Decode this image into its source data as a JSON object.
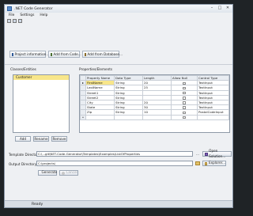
{
  "window": {
    "title": ".NET Code Generator"
  },
  "menu": [
    "File",
    "Settings",
    "Help"
  ],
  "toolbar": {
    "project_info": "Project information...",
    "add_from_code": "Add from Code...",
    "add_from_db": "Add from Database..."
  },
  "classes": {
    "label": "Classes/Entities",
    "items": [
      "Customer"
    ],
    "add": "Add",
    "rename": "Rename",
    "remove": "Remove"
  },
  "properties": {
    "label": "Properties/Elements",
    "columns": [
      "Property Name",
      "Data Type",
      "Length",
      "Allow Null",
      "Control Type"
    ],
    "rows": [
      {
        "name": "FirstName",
        "type": "String",
        "length": "20",
        "control": "TextInput"
      },
      {
        "name": "LastName",
        "type": "String",
        "length": "25",
        "control": "TextInput"
      },
      {
        "name": "Street1",
        "type": "String",
        "length": "",
        "control": "TextInput"
      },
      {
        "name": "Street2",
        "type": "String",
        "length": "",
        "control": "TextInput"
      },
      {
        "name": "City",
        "type": "String",
        "length": "20",
        "control": "TextInput"
      },
      {
        "name": "State",
        "type": "String",
        "length": "30",
        "control": "TextInput"
      },
      {
        "name": "Zip",
        "type": "String",
        "length": "10",
        "control": "PostalCodeInput"
      }
    ]
  },
  "template_dir": {
    "label": "Template Directory",
    "value": "C:\\...git\\NET-Code-Generator\\Templates\\Examples\\ListOfProperties",
    "open_solution": "Open Solution..."
  },
  "output_dir": {
    "label": "Output Directory",
    "value": "C:\\projects\\",
    "explorer": "Explorer..."
  },
  "actions": {
    "generate": "Generate",
    "cancel": "Cancel"
  },
  "status": "Ready"
}
